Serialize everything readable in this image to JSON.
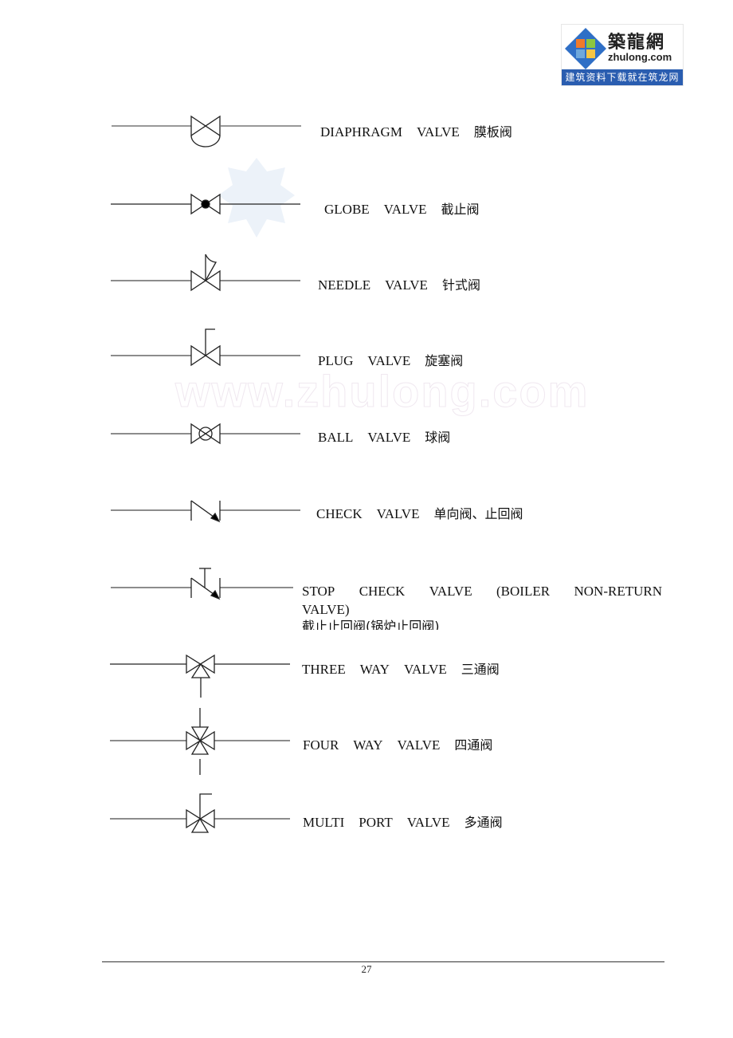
{
  "logo": {
    "brand_cn": "築龍網",
    "brand_en": "zhulong.com",
    "slogan": "建筑资料下载就在筑龙网",
    "colors": {
      "slogan_bg": "#2a5db0"
    }
  },
  "watermark": {
    "text": "www.zhulong.com"
  },
  "valves": [
    {
      "id": "diaphragm",
      "icon": "diaphragm-valve-symbol",
      "words": [
        "DIAPHRAGM",
        "VALVE"
      ],
      "cn": "膜板阀"
    },
    {
      "id": "globe",
      "icon": "globe-valve-symbol",
      "words": [
        "GLOBE",
        "VALVE"
      ],
      "cn": "截止阀"
    },
    {
      "id": "needle",
      "icon": "needle-valve-symbol",
      "words": [
        "NEEDLE",
        "VALVE"
      ],
      "cn": "针式阀"
    },
    {
      "id": "plug",
      "icon": "plug-valve-symbol",
      "words": [
        "PLUG",
        "VALVE"
      ],
      "cn": "旋塞阀"
    },
    {
      "id": "ball",
      "icon": "ball-valve-symbol",
      "words": [
        "BALL",
        "VALVE"
      ],
      "cn": "球阀"
    },
    {
      "id": "check",
      "icon": "check-valve-symbol",
      "words": [
        "CHECK",
        "VALVE"
      ],
      "cn": "单向阀、止回阀"
    },
    {
      "id": "stop-check",
      "icon": "stop-check-valve-symbol",
      "words": [
        "STOP",
        "CHECK",
        "VALVE",
        "(BOILER",
        "NON-RETURN",
        "VALVE)"
      ],
      "cn": "截止止回阀(锅炉止回阀)"
    },
    {
      "id": "three-way",
      "icon": "three-way-valve-symbol",
      "words": [
        "THREE",
        "WAY",
        "VALVE"
      ],
      "cn": "三通阀"
    },
    {
      "id": "four-way",
      "icon": "four-way-valve-symbol",
      "words": [
        "FOUR",
        "WAY",
        "VALVE"
      ],
      "cn": "四通阀"
    },
    {
      "id": "multi-port",
      "icon": "multi-port-valve-symbol",
      "words": [
        "MULTI",
        "PORT",
        "VALVE"
      ],
      "cn": "多通阀"
    }
  ],
  "footer": {
    "page_number": "27"
  }
}
